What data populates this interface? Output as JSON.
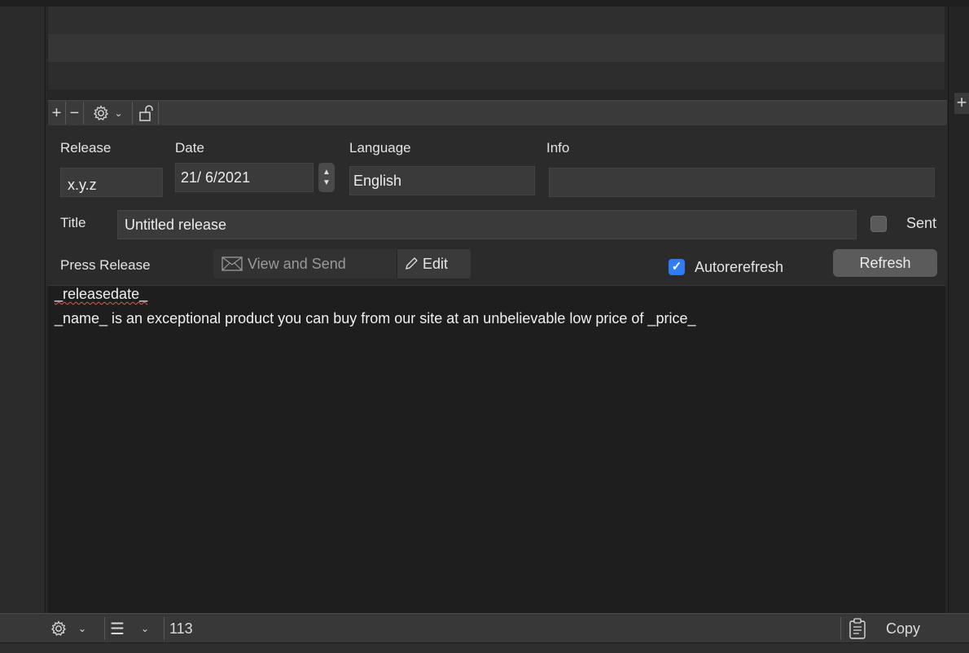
{
  "toolbar": {
    "add_icon": "plus-icon",
    "remove_icon": "minus-icon",
    "settings_icon": "gear-icon",
    "lock_icon": "unlock-icon"
  },
  "form": {
    "release": {
      "label": "Release",
      "value": "x.y.z"
    },
    "date": {
      "label": "Date",
      "value": "21/ 6/2021"
    },
    "language": {
      "label": "Language",
      "value": "English"
    },
    "info": {
      "label": "Info",
      "value": ""
    },
    "title": {
      "label": "Title",
      "value": "Untitled release"
    },
    "sent": {
      "label": "Sent",
      "checked": false
    }
  },
  "press_release": {
    "label": "Press Release",
    "view_and_send_label": "View and Send",
    "edit_label": "Edit",
    "autorefresh_label": "Autorerefresh",
    "autorefresh_checked": true,
    "refresh_label": "Refresh"
  },
  "editor": {
    "lines": [
      "_releasedate_",
      "_name_ is an exceptional product you can buy from our site at an unbelievable low price of _price_"
    ]
  },
  "statusbar": {
    "count": "113",
    "copy_label": "Copy"
  },
  "colors": {
    "accent": "#2f7cf6",
    "background": "#1e1e1e",
    "spellcheck": "#e05555"
  }
}
